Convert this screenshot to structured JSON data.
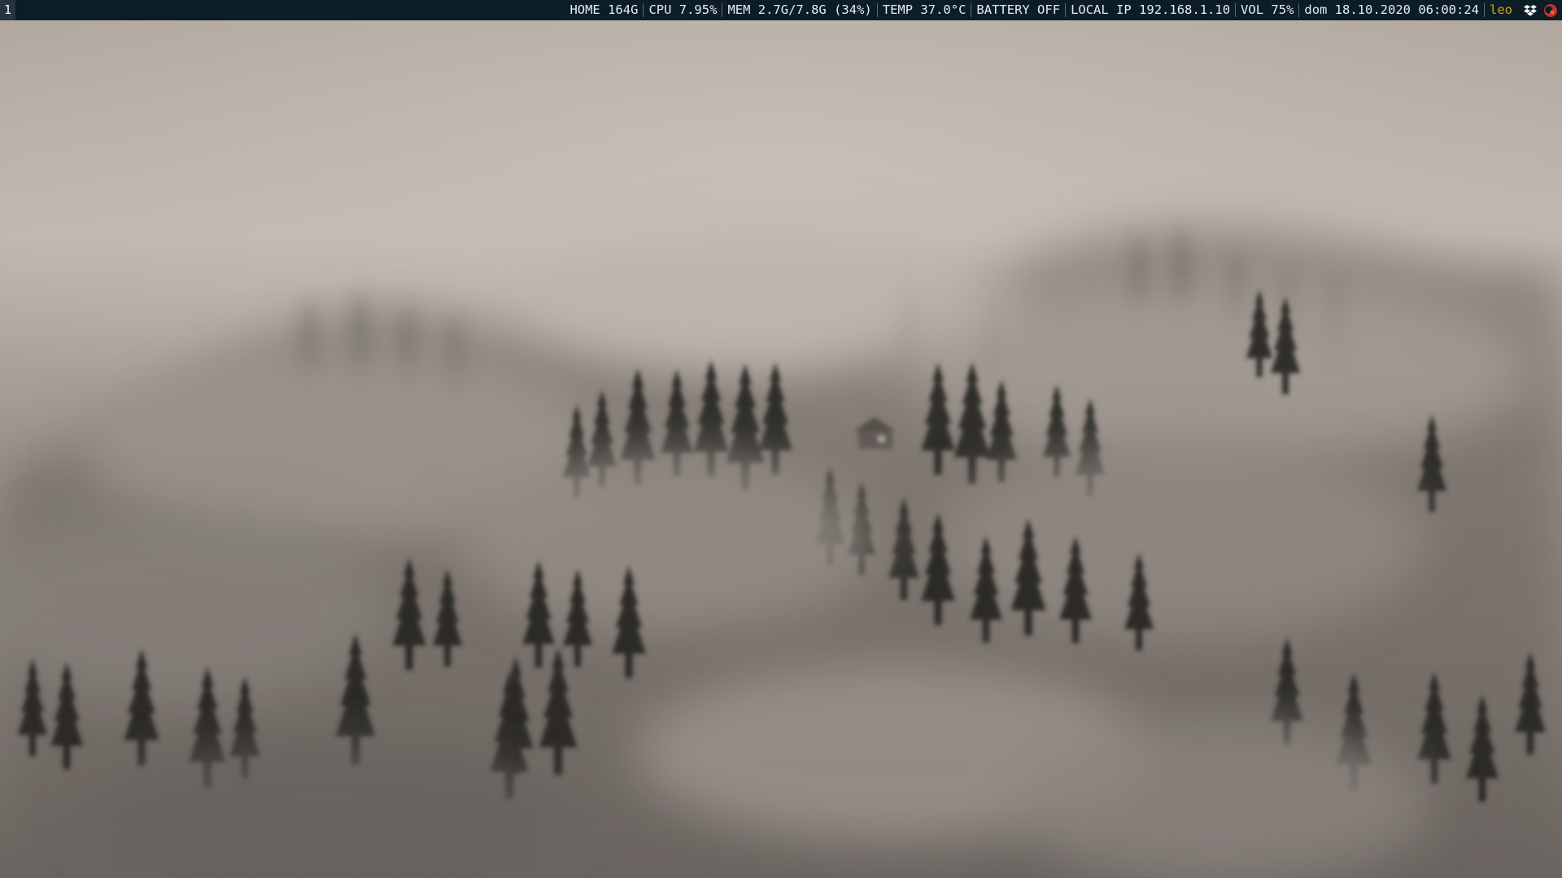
{
  "workspace": {
    "label": "1"
  },
  "status": {
    "home": "HOME 164G",
    "cpu": "CPU 7.95%",
    "mem": "MEM 2.7G/7.8G (34%)",
    "temp": "TEMP 37.0°C",
    "battery": "BATTERY OFF",
    "ip": "LOCAL IP 192.168.1.10",
    "volume": "VOL 75%",
    "datetime": "dom 18.10.2020 06:00:24",
    "user": "leo"
  },
  "tray": {
    "icons": [
      "dropbox-icon",
      "redshift-icon"
    ]
  },
  "colors": {
    "bar_background": "#0b1d26",
    "bar_text": "#e8ecef",
    "user_accent": "#d8a616",
    "workspace_background": "#26343d"
  },
  "wallpaper": {
    "subject": "foggy-forest"
  }
}
